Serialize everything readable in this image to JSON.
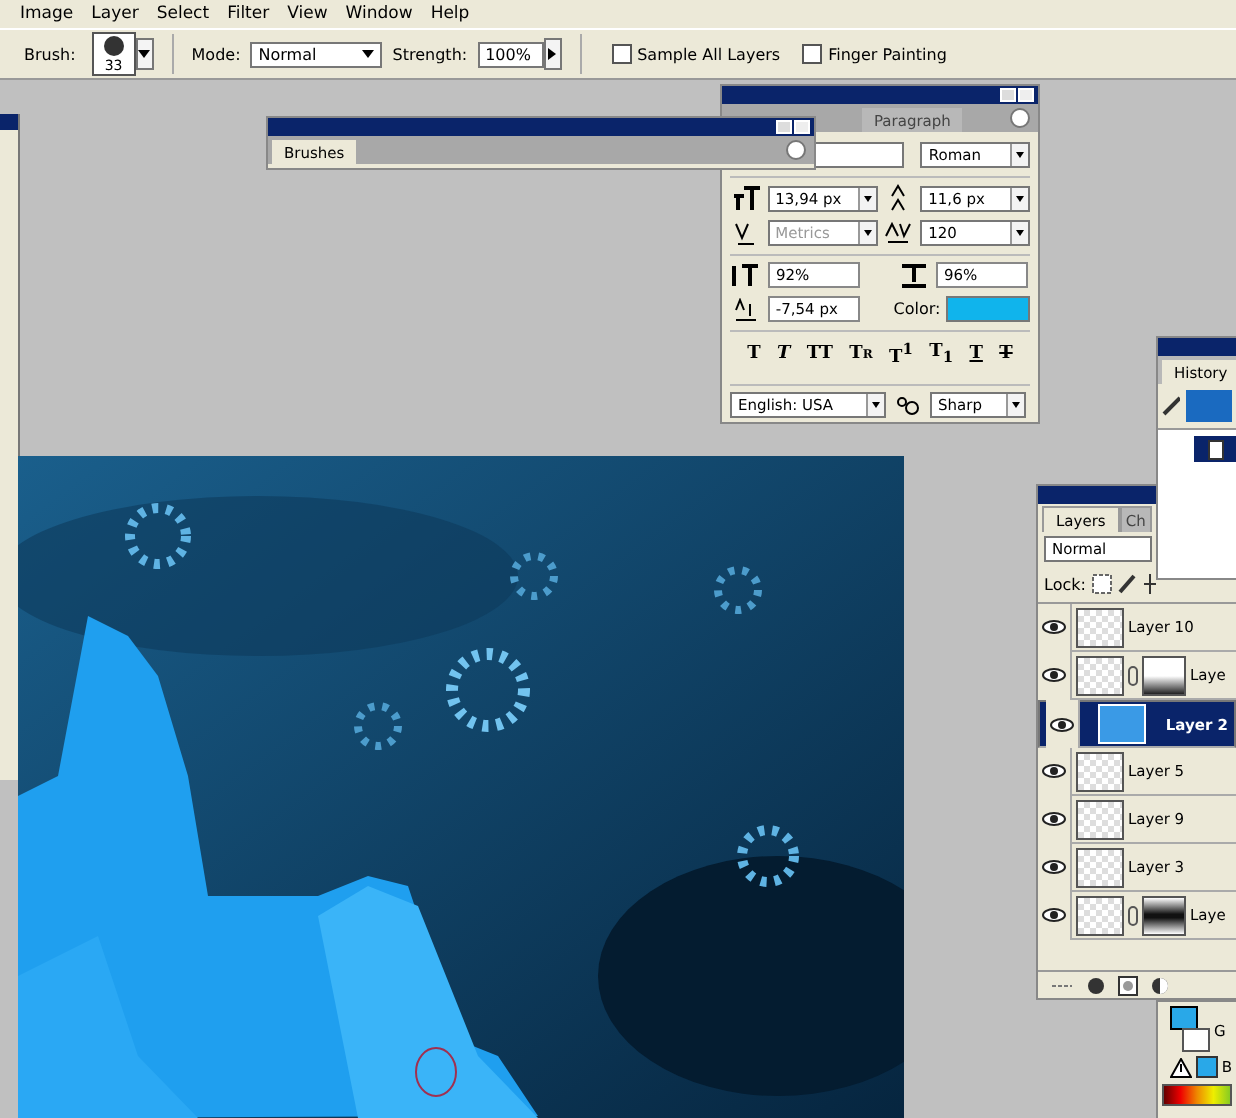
{
  "menu": [
    "Image",
    "Layer",
    "Select",
    "Filter",
    "View",
    "Window",
    "Help"
  ],
  "options": {
    "brush_label": "Brush:",
    "brush_size": "33",
    "mode_label": "Mode:",
    "mode": "Normal",
    "strength_label": "Strength:",
    "strength": "100%",
    "checkboxes": [
      {
        "label": "Sample All Layers",
        "checked": false
      },
      {
        "label": "Finger Painting",
        "checked": false
      }
    ]
  },
  "brushes_palette": {
    "tab": "Brushes"
  },
  "character_palette": {
    "tab": "Paragraph",
    "font_style": "Roman",
    "size": "13,94 px",
    "leading": "11,6 px",
    "kerning": {
      "value": "Metrics",
      "disabled": true
    },
    "tracking": {
      "value": "120",
      "disabled": false
    },
    "vertical_scale": "92%",
    "horizontal_scale": "96%",
    "baseline_shift": "-7,54 px",
    "color_label": "Color:",
    "color": "#10b4ec",
    "styles": [
      {
        "glyph": "T",
        "kind": "bold"
      },
      {
        "glyph": "T",
        "kind": "italic"
      },
      {
        "glyph": "TT",
        "kind": "caps"
      },
      {
        "glyph": "Tr",
        "kind": "smallcaps"
      },
      {
        "glyph": "T$^{1}$",
        "kind": "super"
      },
      {
        "glyph": "T$_{1}$",
        "kind": "sub"
      },
      {
        "glyph": "T",
        "kind": "underline"
      },
      {
        "glyph": "T",
        "kind": "strike"
      }
    ],
    "language": "English: USA",
    "antialias": "Sharp"
  },
  "history_palette": {
    "tab": "History"
  },
  "layers_palette": {
    "tabs": [
      {
        "label": "Layers",
        "selected": true
      },
      {
        "label": "Ch",
        "selected": false
      }
    ],
    "blend_mode": "Normal",
    "lock_label": "Lock:",
    "layers": [
      {
        "name": "Layer 10",
        "visible": true,
        "selected": false,
        "kind": "plain"
      },
      {
        "name": "Laye",
        "visible": true,
        "selected": false,
        "kind": "fade_mask"
      },
      {
        "name": "Layer 2",
        "visible": true,
        "selected": true,
        "kind": "plain"
      },
      {
        "name": "Layer 5",
        "visible": true,
        "selected": false,
        "kind": "plain"
      },
      {
        "name": "Layer 9",
        "visible": true,
        "selected": false,
        "kind": "plain"
      },
      {
        "name": "Layer 3",
        "visible": true,
        "selected": false,
        "kind": "plain"
      },
      {
        "name": "Laye",
        "visible": true,
        "selected": false,
        "kind": "band_mask"
      }
    ]
  },
  "color_palette": {
    "channels": [
      "G",
      "B"
    ]
  }
}
